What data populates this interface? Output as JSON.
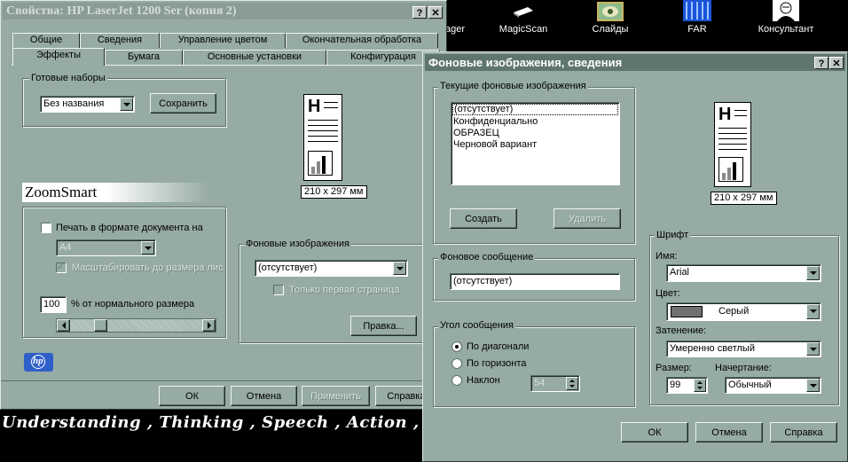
{
  "desktop": {
    "icons": [
      {
        "label": "ager",
        "icon": "app-icon"
      },
      {
        "label": "MagicScan",
        "icon": "scanner-icon"
      },
      {
        "label": "Слайды",
        "icon": "slides-icon"
      },
      {
        "label": "FAR",
        "icon": "far-icon"
      },
      {
        "label": "Консультант",
        "icon": "consultant-icon"
      }
    ],
    "banner": "Understanding , Thinking , Speech , Action , Live"
  },
  "props": {
    "title": "Свойства: HP LaserJet 1200 Ser (копия 2)",
    "help_glyph": "?",
    "close_glyph": "✕",
    "tabs_row1": [
      "Общие",
      "Сведения",
      "Управление цветом",
      "Окончательная обработка"
    ],
    "tabs_row2": [
      "Эффекты",
      "Бумага",
      "Основные установки",
      "Конфигурация"
    ],
    "presets": {
      "label": "Готовые наборы",
      "value": "Без названия",
      "save": "Сохранить"
    },
    "zoomsmart": "ZoomSmart",
    "print_as": {
      "label": "Печать в формате документа на",
      "paper": "A4",
      "scale_label": "Масштабировать до размера лис"
    },
    "percent": {
      "value": "100",
      "label": "% от нормального размера"
    },
    "paper_size": "210 x 297 мм",
    "watermark": {
      "label": "Фоновые изображения",
      "value": "(отсутствует)",
      "first_page": "Только первая страница",
      "edit": "Правка..."
    },
    "hp_logo": "hp",
    "buttons": {
      "ok": "ОК",
      "cancel": "Отмена",
      "apply": "Применить",
      "help": "Справка"
    }
  },
  "wm": {
    "title": "Фоновые изображения, сведения",
    "help_glyph": "?",
    "close_glyph": "✕",
    "current": {
      "label": "Текущие фоновые изображения",
      "items": [
        "(отсутствует)",
        "Конфиденциально",
        "ОБРАЗЕЦ",
        "Черновой вариант"
      ],
      "create": "Создать",
      "delete": "Удалить"
    },
    "message": {
      "label": "Фоновое сообщение",
      "value": "(отсутствует)"
    },
    "angle": {
      "label": "Угол сообщения",
      "diagonal": "По диагонали",
      "horizontal": "По горизонта",
      "tilt": "Наклон",
      "tilt_value": "54"
    },
    "paper_size": "210 x 297 мм",
    "font": {
      "label": "Шрифт",
      "name_label": "Имя:",
      "name_value": "Arial",
      "color_label": "Цвет:",
      "color_value": "Серый",
      "swatch": "#707070",
      "shade_label": "Затенение:",
      "shade_value": "Умеренно светлый",
      "size_label": "Размер:",
      "size_value": "99",
      "style_label": "Начертание:",
      "style_value": "Обычный"
    },
    "buttons": {
      "ok": "ОК",
      "cancel": "Отмена",
      "help": "Справка"
    }
  }
}
